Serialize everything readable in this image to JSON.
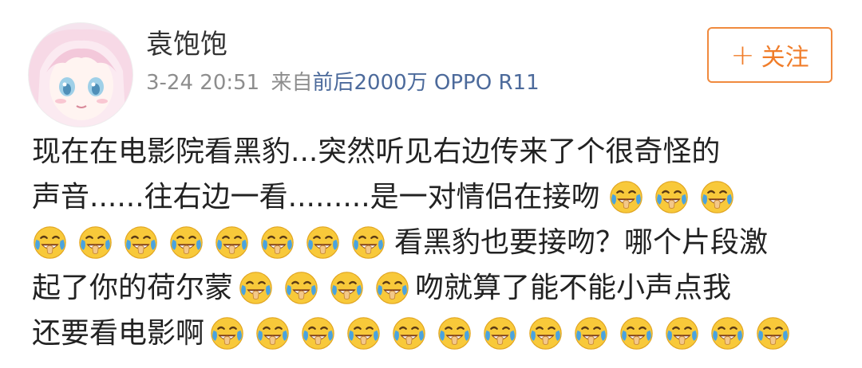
{
  "user": {
    "name": "袁饱饱",
    "avatar_icon": "anime-girl-avatar-icon"
  },
  "meta": {
    "time": "3-24 20:51",
    "from_label": "来自",
    "source": "前后2000万 OPPO R11"
  },
  "follow": {
    "plus": "+",
    "label": "关注"
  },
  "post": {
    "line1": "现在在电影院看黑豹...突然听见右边传来了个很奇怪的",
    "line2": "声音......往右边一看.........是一对情侣在接吻",
    "line3": "看黑豹也要接吻？哪个片段激",
    "line4a": "起了你的荷尔蒙",
    "line4b": "吻就算了能不能小声点我",
    "line5": "还要看电影啊"
  },
  "emoji": {
    "name": "laugh-cry-emoji-icon",
    "face_color": "#f8c93a",
    "tear_color": "#4aa3df"
  },
  "colors": {
    "follow_accent": "#f07d2a",
    "source_link": "#4c6a9b",
    "meta_gray": "#8d8d8d"
  }
}
